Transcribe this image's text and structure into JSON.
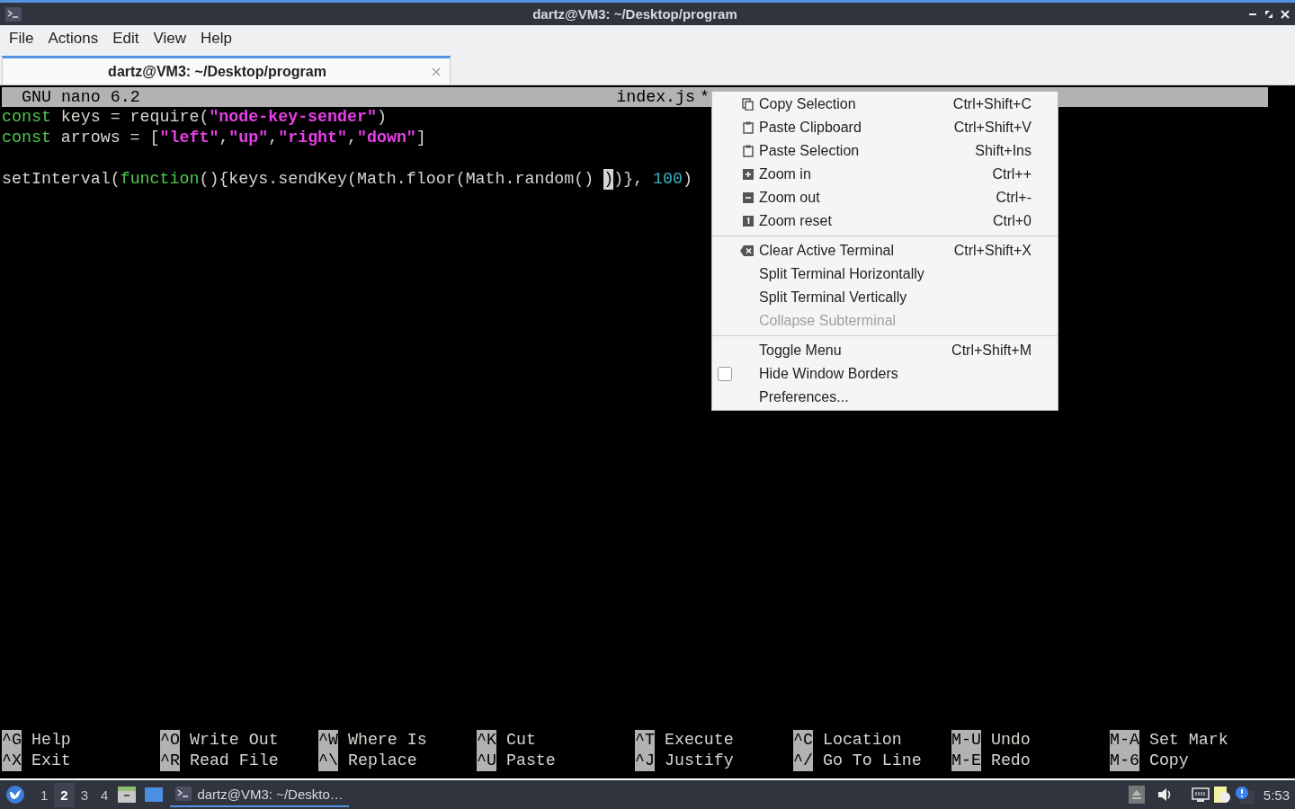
{
  "window": {
    "title": "dartz@VM3: ~/Desktop/program"
  },
  "menubar": [
    "File",
    "Actions",
    "Edit",
    "View",
    "Help"
  ],
  "tabs": [
    {
      "label": "dartz@VM3: ~/Desktop/program",
      "selected": true
    }
  ],
  "nano": {
    "header": {
      "version": "GNU nano 6.2",
      "filename": "index.js",
      "modified": "*"
    },
    "lines": [
      {
        "kind": "code",
        "segments": [
          {
            "kind": "keyword",
            "text": "const"
          },
          {
            "kind": "plain",
            "text": " keys = require("
          },
          {
            "kind": "string",
            "text": "\"node-key-sender\""
          },
          {
            "kind": "plain",
            "text": ")"
          }
        ]
      },
      {
        "kind": "code",
        "segments": [
          {
            "kind": "keyword",
            "text": "const"
          },
          {
            "kind": "plain",
            "text": " arrows = ["
          },
          {
            "kind": "string",
            "text": "\"left\""
          },
          {
            "kind": "plain",
            "text": ","
          },
          {
            "kind": "string",
            "text": "\"up\""
          },
          {
            "kind": "plain",
            "text": ","
          },
          {
            "kind": "string",
            "text": "\"right\""
          },
          {
            "kind": "plain",
            "text": ","
          },
          {
            "kind": "string",
            "text": "\"down\""
          },
          {
            "kind": "plain",
            "text": "]"
          }
        ]
      },
      {
        "kind": "blank"
      },
      {
        "kind": "code",
        "segments": [
          {
            "kind": "plain",
            "text": "setInterval("
          },
          {
            "kind": "keyword",
            "text": "function"
          },
          {
            "kind": "plain",
            "text": "(){keys.sendKey(Math.floor(Math.random() "
          },
          {
            "kind": "cursor",
            "text": ")"
          },
          {
            "kind": "plain",
            "text": ")}, "
          },
          {
            "kind": "number",
            "text": "100"
          },
          {
            "kind": "plain",
            "text": ")"
          }
        ]
      }
    ],
    "shortcuts": [
      [
        {
          "key": "^G",
          "label": "Help"
        },
        {
          "key": "^X",
          "label": "Exit"
        }
      ],
      [
        {
          "key": "^O",
          "label": "Write Out"
        },
        {
          "key": "^R",
          "label": "Read File"
        }
      ],
      [
        {
          "key": "^W",
          "label": "Where Is"
        },
        {
          "key": "^\\",
          "label": "Replace"
        }
      ],
      [
        {
          "key": "^K",
          "label": "Cut"
        },
        {
          "key": "^U",
          "label": "Paste"
        }
      ],
      [
        {
          "key": "^T",
          "label": "Execute"
        },
        {
          "key": "^J",
          "label": "Justify"
        }
      ],
      [
        {
          "key": "^C",
          "label": "Location"
        },
        {
          "key": "^/",
          "label": "Go To Line"
        }
      ],
      [
        {
          "key": "M-U",
          "label": "Undo"
        },
        {
          "key": "M-E",
          "label": "Redo"
        }
      ],
      [
        {
          "key": "M-A",
          "label": "Set Mark"
        },
        {
          "key": "M-6",
          "label": "Copy"
        }
      ]
    ]
  },
  "context_menu": {
    "groups": [
      [
        {
          "kind": "copy",
          "label": "Copy Selection",
          "shortcut": "Ctrl+Shift+C",
          "disabled": false
        },
        {
          "kind": "paste",
          "label": "Paste Clipboard",
          "shortcut": "Ctrl+Shift+V",
          "disabled": false
        },
        {
          "kind": "paste",
          "label": "Paste Selection",
          "shortcut": "Shift+Ins",
          "disabled": false
        },
        {
          "kind": "zoomin",
          "label": "Zoom in",
          "shortcut": "Ctrl++",
          "disabled": false
        },
        {
          "kind": "zoomout",
          "label": "Zoom out",
          "shortcut": "Ctrl+-",
          "disabled": false
        },
        {
          "kind": "zoomreset",
          "label": "Zoom reset",
          "shortcut": "Ctrl+0",
          "disabled": false
        }
      ],
      [
        {
          "kind": "clear",
          "label": "Clear Active Terminal",
          "shortcut": "Ctrl+Shift+X",
          "disabled": false
        },
        {
          "kind": "plain",
          "label": "Split Terminal Horizontally",
          "disabled": false
        },
        {
          "kind": "plain",
          "label": "Split Terminal Vertically",
          "disabled": false
        },
        {
          "kind": "plain",
          "label": "Collapse Subterminal",
          "disabled": true
        }
      ],
      [
        {
          "kind": "plain",
          "label": "Toggle Menu",
          "shortcut": "Ctrl+Shift+M",
          "disabled": false
        },
        {
          "kind": "check",
          "label": "Hide Window Borders",
          "checked": false,
          "disabled": false
        },
        {
          "kind": "plain",
          "label": "Preferences...",
          "disabled": false
        }
      ]
    ]
  },
  "taskbar": {
    "workspaces": [
      {
        "label": "1",
        "selected": false
      },
      {
        "label": "2",
        "selected": true
      },
      {
        "label": "3",
        "selected": false
      },
      {
        "label": "4",
        "selected": false
      }
    ],
    "tasks": [
      {
        "label": "dartz@VM3: ~/Deskto…",
        "selected": true
      }
    ],
    "clock": "5:53"
  }
}
